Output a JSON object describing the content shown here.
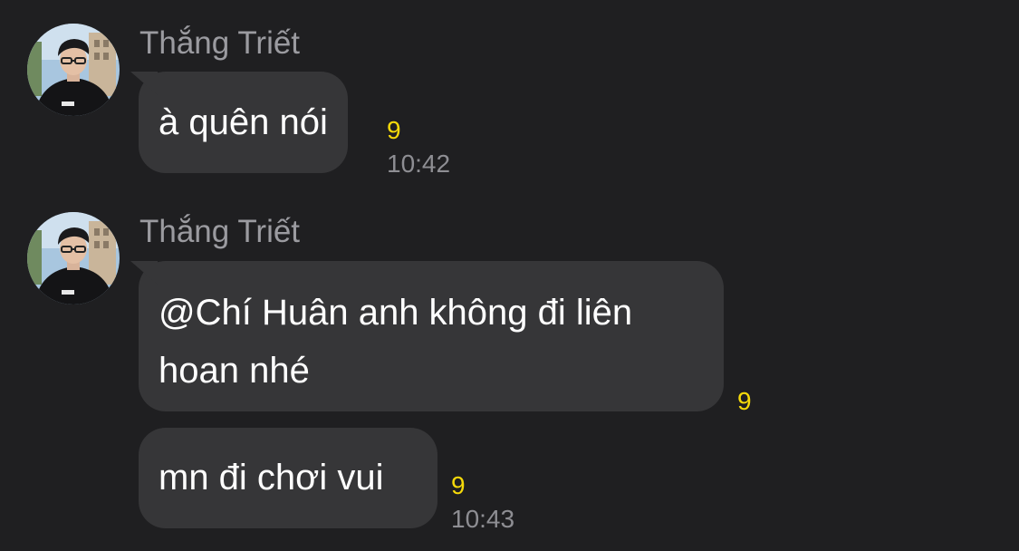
{
  "messages": [
    {
      "sender": "Thắng Triết",
      "bubbles": [
        {
          "text": "à quên nói",
          "reaction": "9",
          "time": "10:42"
        }
      ]
    },
    {
      "sender": "Thắng Triết",
      "bubbles": [
        {
          "line1": "@Chí Huân anh không đi liên",
          "line2": "hoan nhé",
          "reaction": "9"
        },
        {
          "text": "mn đi chơi vui",
          "reaction": "9",
          "time": "10:43"
        }
      ]
    }
  ],
  "colors": {
    "background": "#1f1f21",
    "bubble": "#363638",
    "sender_name": "#9b9ba0",
    "timestamp": "#8e8e93",
    "reaction": "#f5d90a"
  },
  "icons": {
    "avatar": "user-avatar-photo"
  }
}
